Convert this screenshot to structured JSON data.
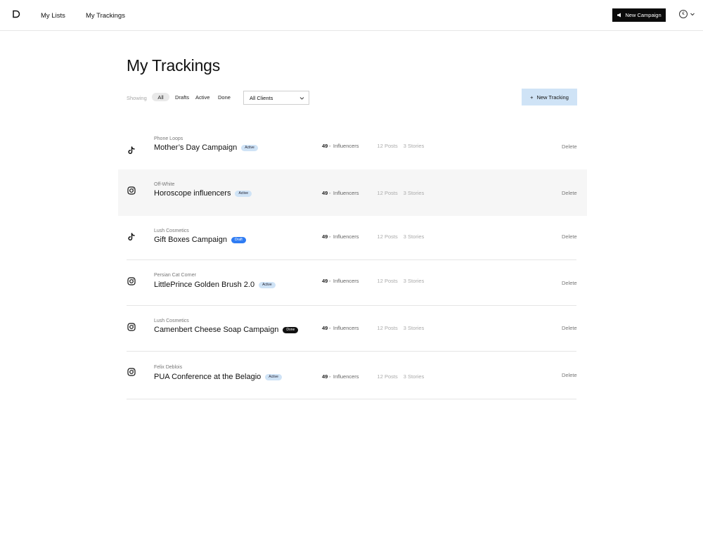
{
  "nav": {
    "my_lists": "My Lists",
    "my_trackings": "My Trackings",
    "new_campaign": "New Campaign",
    "account_glyph": "€"
  },
  "page": {
    "title": "My Trackings"
  },
  "filters": {
    "showing_label": "Showing",
    "tabs": [
      "All",
      "Drafts",
      "Active",
      "Done"
    ],
    "selected_tab": "All",
    "client_select": "All Clients",
    "new_tracking": "New Tracking"
  },
  "colors": {
    "accent_light_blue": "#cfe3f6",
    "draft_blue": "#2f7cf3",
    "dark": "#0b0b0b"
  },
  "rows": [
    {
      "platform": "tiktok-icon",
      "client": "Phone Loops",
      "name": "Mother’s Day Campaign",
      "status": "Active",
      "influencers_count": "49",
      "influencers_label": "Influencers",
      "posts": "12 Posts",
      "stories": "3 Stories",
      "delete": "Delete"
    },
    {
      "platform": "instagram-icon",
      "client": "Off-White",
      "name": "Horoscope influencers",
      "status": "Active",
      "influencers_count": "49",
      "influencers_label": "Influencers",
      "posts": "12 Posts",
      "stories": "3 Stories",
      "delete": "Delete"
    },
    {
      "platform": "tiktok-icon",
      "client": "Lush Cosmetics",
      "name": "Gift Boxes Campaign",
      "status": "Draft",
      "influencers_count": "49",
      "influencers_label": "Influencers",
      "posts": "12 Posts",
      "stories": "3 Stories",
      "delete": "Delete"
    },
    {
      "platform": "instagram-icon",
      "client": "Persian Cat Corner",
      "name": "LittlePrince Golden Brush 2.0",
      "status": "Active",
      "influencers_count": "49",
      "influencers_label": "Influencers",
      "posts": "12 Posts",
      "stories": "3 Stories",
      "delete": "Delete"
    },
    {
      "platform": "instagram-icon",
      "client": "Lush Cosmetics",
      "name": "Camenbert Cheese Soap Campaign",
      "status": "Done",
      "influencers_count": "49",
      "influencers_label": "Influencers",
      "posts": "12 Posts",
      "stories": "3 Stories",
      "delete": "Delete"
    },
    {
      "platform": "instagram-icon",
      "client": "Felix Deblois",
      "name": "PUA Conference at the Belagio",
      "status": "Active",
      "influencers_count": "49",
      "influencers_label": "Influencers",
      "posts": "12 Posts",
      "stories": "3 Stories",
      "delete": "Delete"
    }
  ]
}
